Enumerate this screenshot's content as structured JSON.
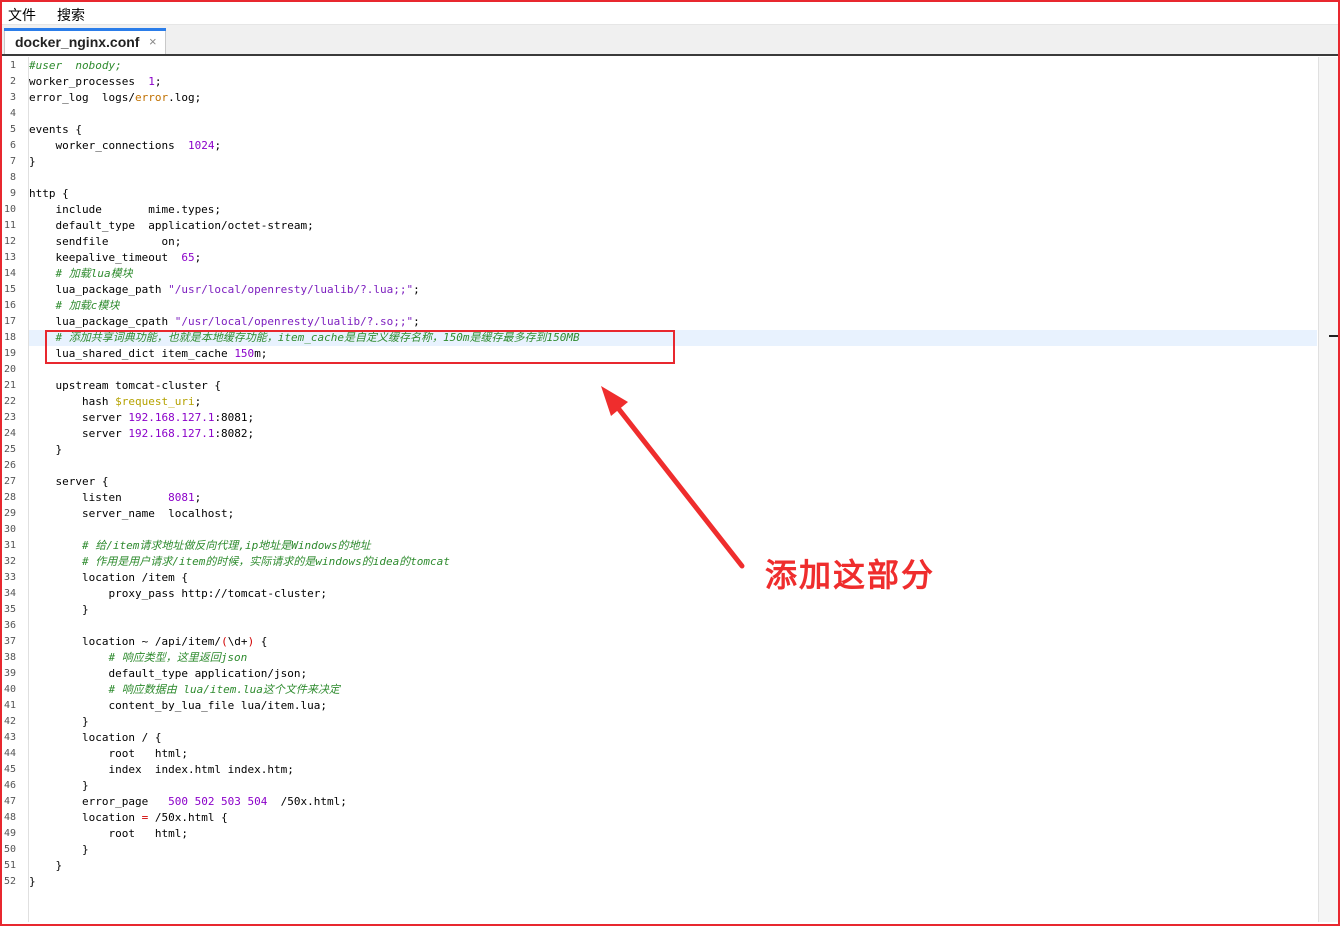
{
  "menu": {
    "file": "文件",
    "search": "搜索"
  },
  "tab": {
    "title": "docker_nginx.conf",
    "close": "×"
  },
  "annotation": {
    "text": "添加这部分",
    "color": "#ef2d2d"
  },
  "colors": {
    "frame": "#e8282f",
    "tab_accent": "#2b7de9",
    "current_line": "#e8f2fe"
  },
  "editor": {
    "current_line": 18,
    "lines": [
      [
        {
          "t": "#user  nobody;",
          "c": "com"
        }
      ],
      [
        {
          "t": "worker_processes  "
        },
        {
          "t": "1",
          "c": "num"
        },
        {
          "t": ";"
        }
      ],
      [
        {
          "t": "error_log  logs/"
        },
        {
          "t": "error",
          "c": "kw"
        },
        {
          "t": ".log;"
        }
      ],
      [],
      [
        {
          "t": "events {"
        }
      ],
      [
        {
          "t": "    worker_connections  "
        },
        {
          "t": "1024",
          "c": "num"
        },
        {
          "t": ";"
        }
      ],
      [
        {
          "t": "}"
        }
      ],
      [],
      [
        {
          "t": "http {"
        }
      ],
      [
        {
          "t": "    include       mime.types;"
        }
      ],
      [
        {
          "t": "    default_type  application/octet-stream;"
        }
      ],
      [
        {
          "t": "    sendfile        on;"
        }
      ],
      [
        {
          "t": "    keepalive_timeout  "
        },
        {
          "t": "65",
          "c": "num"
        },
        {
          "t": ";"
        }
      ],
      [
        {
          "t": "    "
        },
        {
          "t": "# 加载lua模块",
          "c": "com"
        }
      ],
      [
        {
          "t": "    lua_package_path "
        },
        {
          "t": "\"/usr/local/openresty/lualib/?.lua;;\"",
          "c": "str"
        },
        {
          "t": ";"
        }
      ],
      [
        {
          "t": "    "
        },
        {
          "t": "# 加载c模块",
          "c": "com"
        }
      ],
      [
        {
          "t": "    lua_package_cpath "
        },
        {
          "t": "\"/usr/local/openresty/lualib/?.so;;\"",
          "c": "str"
        },
        {
          "t": ";"
        }
      ],
      [
        {
          "t": "    "
        },
        {
          "t": "# 添加共享词典功能，也就是本地缓存功能，item_cache是自定义缓存名称，150m是缓存最多存到150MB",
          "c": "com"
        }
      ],
      [
        {
          "t": "    lua_shared_dict item_cache "
        },
        {
          "t": "150",
          "c": "num"
        },
        {
          "t": "m;"
        }
      ],
      [],
      [
        {
          "t": "    upstream tomcat-cluster {"
        }
      ],
      [
        {
          "t": "        hash "
        },
        {
          "t": "$request_uri",
          "c": "var"
        },
        {
          "t": ";"
        }
      ],
      [
        {
          "t": "        server "
        },
        {
          "t": "192.168.127.1",
          "c": "num"
        },
        {
          "t": ":8081;"
        }
      ],
      [
        {
          "t": "        server "
        },
        {
          "t": "192.168.127.1",
          "c": "num"
        },
        {
          "t": ":8082;"
        }
      ],
      [
        {
          "t": "    }"
        }
      ],
      [],
      [
        {
          "t": "    server {"
        }
      ],
      [
        {
          "t": "        listen       "
        },
        {
          "t": "8081",
          "c": "num"
        },
        {
          "t": ";"
        }
      ],
      [
        {
          "t": "        server_name  localhost;"
        }
      ],
      [],
      [
        {
          "t": "        "
        },
        {
          "t": "# 给/item请求地址做反向代理,ip地址是Windows的地址",
          "c": "com"
        }
      ],
      [
        {
          "t": "        "
        },
        {
          "t": "# 作用是用户请求/item的时候，实际请求的是windows的idea的tomcat",
          "c": "com"
        }
      ],
      [
        {
          "t": "        location /item {"
        }
      ],
      [
        {
          "t": "            proxy_pass http://tomcat-cluster;"
        }
      ],
      [
        {
          "t": "        }"
        }
      ],
      [],
      [
        {
          "t": "        location ~ /api/item/"
        },
        {
          "t": "(",
          "c": "red"
        },
        {
          "t": "\\d+"
        },
        {
          "t": ")",
          "c": "red"
        },
        {
          "t": " {"
        }
      ],
      [
        {
          "t": "            "
        },
        {
          "t": "# 响应类型，这里返回json",
          "c": "com"
        }
      ],
      [
        {
          "t": "            default_type application/json;"
        }
      ],
      [
        {
          "t": "            "
        },
        {
          "t": "# 响应数据由 lua/item.lua这个文件来决定",
          "c": "com"
        }
      ],
      [
        {
          "t": "            content_by_lua_file lua/item.lua;"
        }
      ],
      [
        {
          "t": "        }"
        }
      ],
      [
        {
          "t": "        location / {"
        }
      ],
      [
        {
          "t": "            root   html;"
        }
      ],
      [
        {
          "t": "            index  index.html index.htm;"
        }
      ],
      [
        {
          "t": "        }"
        }
      ],
      [
        {
          "t": "        error_page   "
        },
        {
          "t": "500 502 503 504",
          "c": "num"
        },
        {
          "t": "  /50x.html;"
        }
      ],
      [
        {
          "t": "        location "
        },
        {
          "t": "=",
          "c": "red"
        },
        {
          "t": " /50x.html {"
        }
      ],
      [
        {
          "t": "            root   html;"
        }
      ],
      [
        {
          "t": "        }"
        }
      ],
      [
        {
          "t": "    }"
        }
      ],
      [
        {
          "t": "}"
        }
      ]
    ]
  }
}
